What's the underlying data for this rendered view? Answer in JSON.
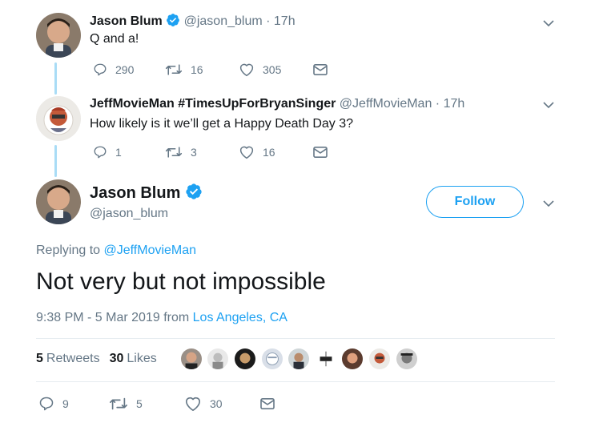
{
  "tweet1": {
    "name": "Jason Blum",
    "handle": "@jason_blum",
    "time": "· 17h",
    "text": "Q and a!",
    "replies": "290",
    "retweets": "16",
    "likes": "305"
  },
  "tweet2": {
    "name": "JeffMovieMan #TimesUpForBryanSinger",
    "handle": "@JeffMovieMan",
    "time": "· 17h",
    "text": "How likely is it we’ll get a Happy Death Day 3?",
    "replies": "1",
    "retweets": "3",
    "likes": "16"
  },
  "main": {
    "name": "Jason Blum",
    "handle": "@jason_blum",
    "follow_label": "Follow",
    "replying_prefix": "Replying to",
    "replying_to": "@JeffMovieMan",
    "text": "Not very but not impossible",
    "timestamp": "9:38 PM - 5 Mar 2019 from",
    "location": "Los Angeles, CA",
    "retweets_count": "5",
    "retweets_label": "Retweets",
    "likes_count": "30",
    "likes_label": "Likes",
    "replies": "9",
    "retweets": "5",
    "likes": "30"
  },
  "colors": {
    "accent": "#1da1f2",
    "thread": "#a9dcf6",
    "muted": "#657786"
  },
  "icons": [
    "verified-badge-icon",
    "reply-icon",
    "retweet-icon",
    "heart-icon",
    "mail-icon",
    "chevron-down-icon"
  ]
}
